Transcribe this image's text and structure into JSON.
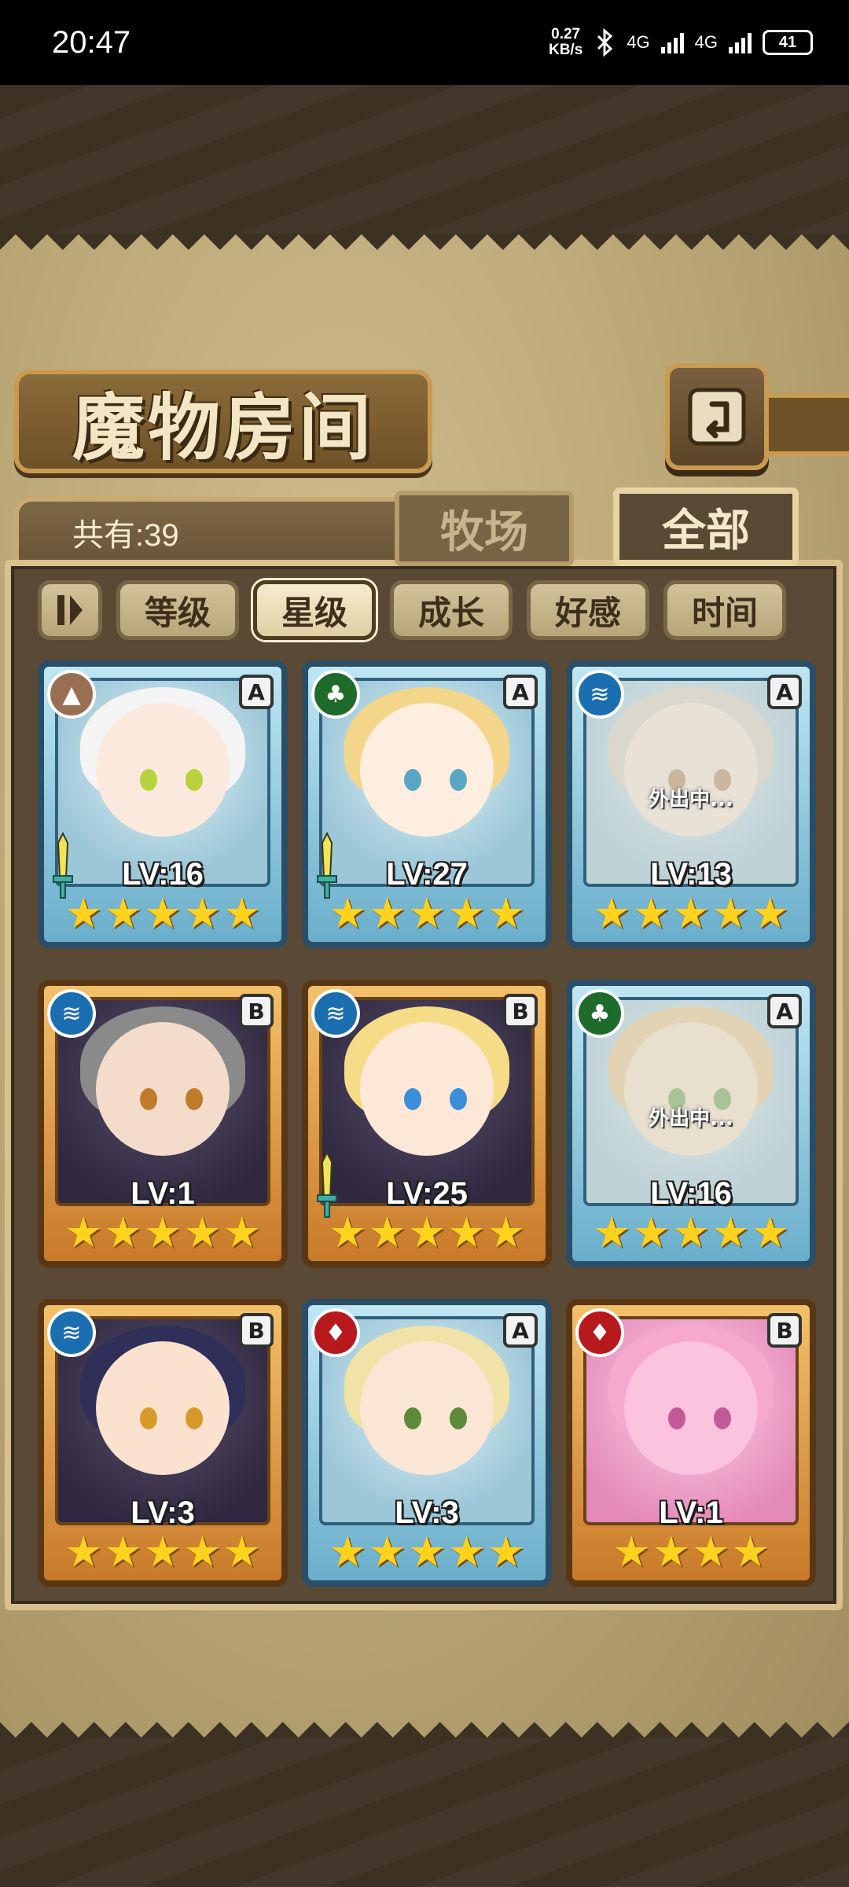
{
  "status_bar": {
    "time": "20:47",
    "speed_value": "0.27",
    "speed_unit": "KB/s",
    "bluetooth": "bluetooth-icon",
    "net1": "4G",
    "net2": "4G",
    "battery": "41"
  },
  "title": "魔物房间",
  "back_icon": "back-arrow-icon",
  "count_label": "共有:39",
  "tabs": {
    "farm": "牧场",
    "all": "全部",
    "selected": "全部"
  },
  "sort": {
    "toggle_icon": "sort-direction-icon",
    "options": [
      "等级",
      "星级",
      "成长",
      "好感",
      "时间"
    ],
    "selected": "星级"
  },
  "away_text": "外出中...",
  "monsters": [
    {
      "lv": "LV:16",
      "rank": "A",
      "element": "earth",
      "frame": "blue",
      "stars": 5,
      "weapon": true,
      "away": false,
      "hair": "#f4f4f4",
      "skin": "#fbe9de",
      "eye": "#b7d23a"
    },
    {
      "lv": "LV:27",
      "rank": "A",
      "element": "leaf",
      "frame": "blue",
      "stars": 5,
      "weapon": true,
      "away": false,
      "hair": "#f3d68a",
      "skin": "#fdeedf",
      "eye": "#5aa7c4"
    },
    {
      "lv": "LV:13",
      "rank": "A",
      "element": "water",
      "frame": "blue",
      "stars": 5,
      "weapon": false,
      "away": true,
      "hair": "#d8d2c2",
      "skin": "#f3e6d4",
      "eye": "#b48a5a"
    },
    {
      "lv": "LV:1",
      "rank": "B",
      "element": "water",
      "frame": "gold",
      "stars": 5,
      "weapon": false,
      "away": false,
      "hair": "#8a8a8a",
      "skin": "#f4dccb",
      "eye": "#c07a2a"
    },
    {
      "lv": "LV:25",
      "rank": "B",
      "element": "water",
      "frame": "gold",
      "stars": 5,
      "weapon": true,
      "away": false,
      "hair": "#f6dc86",
      "skin": "#fde8d8",
      "eye": "#3a8fd6"
    },
    {
      "lv": "LV:16",
      "rank": "A",
      "element": "leaf",
      "frame": "blue",
      "stars": 5,
      "weapon": false,
      "away": true,
      "hair": "#e8c88a",
      "skin": "#f6e3c4",
      "eye": "#6aa34a"
    },
    {
      "lv": "LV:3",
      "rank": "B",
      "element": "water",
      "frame": "gold",
      "stars": 5,
      "weapon": false,
      "away": false,
      "hair": "#2f2f5a",
      "skin": "#fbe2cf",
      "eye": "#d79a2a"
    },
    {
      "lv": "LV:3",
      "rank": "A",
      "element": "fire",
      "frame": "blue",
      "stars": 5,
      "weapon": false,
      "away": false,
      "hair": "#f1e2a8",
      "skin": "#fbe6d6",
      "eye": "#5c8a3a"
    },
    {
      "lv": "LV:1",
      "rank": "B",
      "element": "fire",
      "frame": "gold",
      "stars": 4,
      "weapon": false,
      "away": false,
      "hair": "#f7a8cf",
      "skin": "#fbc3dd",
      "eye": "#c25a98",
      "pink": true
    }
  ]
}
